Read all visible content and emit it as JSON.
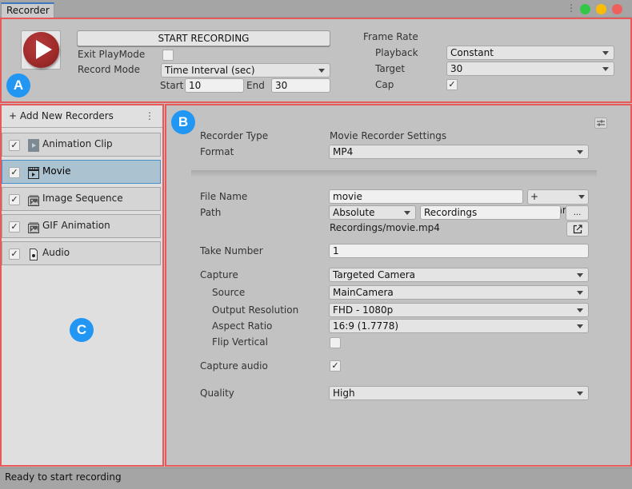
{
  "window": {
    "tab_title": "Recorder",
    "menu_icon": "kebab-menu-icon",
    "traffic_lights": [
      {
        "name": "maximize",
        "color": "#33c748"
      },
      {
        "name": "minimize",
        "color": "#fbbc05"
      },
      {
        "name": "close",
        "color": "#f0605a"
      }
    ]
  },
  "badges": {
    "a": "A",
    "b": "B",
    "c": "C"
  },
  "colors": {
    "region_outline": "#e8595a",
    "badge": "#2196f3",
    "selected_item": "#abc2d0"
  },
  "top": {
    "record_icon": "record-play-icon",
    "start_recording": "START RECORDING",
    "exit_playmode_label": "Exit PlayMode",
    "exit_playmode_checked": false,
    "record_mode_label": "Record Mode",
    "record_mode_value": "Time Interval (sec)",
    "start_label": "Start",
    "start_value": "10",
    "end_label": "End",
    "end_value": "30",
    "frame_rate_label": "Frame Rate",
    "playback_label": "Playback",
    "playback_value": "Constant",
    "target_label": "Target",
    "target_value": "30",
    "cap_label": "Cap",
    "cap_checked": "✓"
  },
  "recorders": {
    "add_label": "+ Add New Recorders",
    "more_icon": "⋮",
    "items": [
      {
        "label": "Animation Clip",
        "checked": "✓",
        "icon": "animation-clip-icon",
        "selected": false
      },
      {
        "label": "Movie",
        "checked": "✓",
        "icon": "movie-clapper-icon",
        "selected": true
      },
      {
        "label": "Image Sequence",
        "checked": "✓",
        "icon": "image-sequence-icon",
        "selected": false
      },
      {
        "label": "GIF Animation",
        "checked": "✓",
        "icon": "gif-animation-icon",
        "selected": false
      },
      {
        "label": "Audio",
        "checked": "✓",
        "icon": "audio-file-icon",
        "selected": false
      }
    ]
  },
  "settings": {
    "recorder_type_label": "Recorder Type",
    "recorder_type_value": "Movie Recorder Settings",
    "format_label": "Format",
    "format_value": "MP4",
    "file_name_label": "File Name",
    "file_name_value": "movie",
    "wildcards_label": "+ Wildcards",
    "path_label": "Path",
    "path_type_value": "Absolute",
    "path_value": "Recordings",
    "browse_label": "...",
    "output_path": "Recordings/movie.mp4",
    "take_number_label": "Take Number",
    "take_number_value": "1",
    "capture_label": "Capture",
    "capture_value": "Targeted Camera",
    "source_label": "Source",
    "source_value": "MainCamera",
    "output_resolution_label": "Output Resolution",
    "output_resolution_value": "FHD - 1080p",
    "aspect_ratio_label": "Aspect Ratio",
    "aspect_ratio_value": "16:9 (1.7778)",
    "flip_vertical_label": "Flip Vertical",
    "flip_vertical_checked": false,
    "capture_audio_label": "Capture audio",
    "capture_audio_checked": "✓",
    "quality_label": "Quality",
    "quality_value": "High"
  },
  "status": {
    "text": "Ready to start recording"
  }
}
